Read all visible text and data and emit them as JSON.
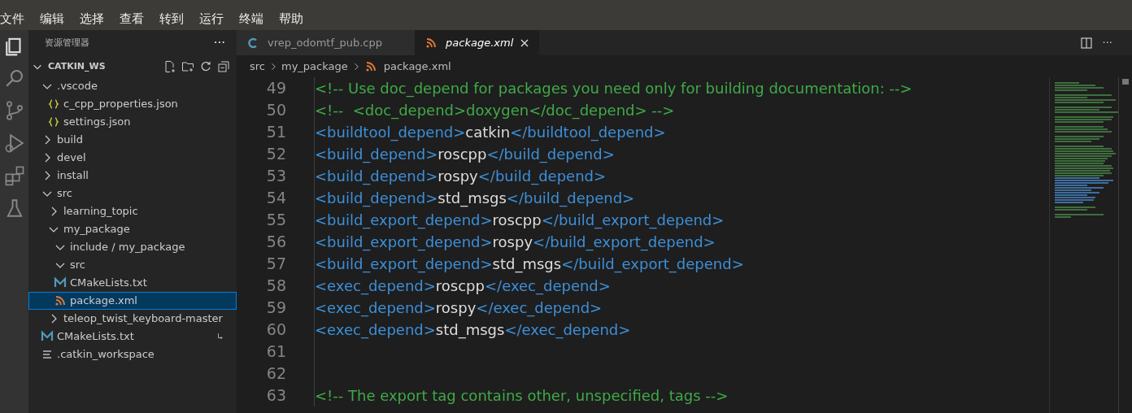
{
  "menu": [
    "文件",
    "编辑",
    "选择",
    "查看",
    "转到",
    "运行",
    "终端",
    "帮助"
  ],
  "activity_bar": [
    {
      "kind": "files",
      "selected": true
    },
    {
      "kind": "search",
      "selected": false
    },
    {
      "kind": "source-control",
      "selected": false
    },
    {
      "kind": "run",
      "selected": false
    },
    {
      "kind": "extensions",
      "selected": false
    },
    {
      "kind": "flask",
      "selected": false
    }
  ],
  "sidebar": {
    "title": "资源管理器",
    "more": "···",
    "workspace": "CATKIN_WS",
    "tree": [
      {
        "label": ".vscode",
        "kind": "folder",
        "expanded": true,
        "selected": false,
        "children": [
          {
            "label": "c_cpp_properties.json",
            "kind": "json",
            "selected": false
          },
          {
            "label": "settings.json",
            "kind": "json",
            "selected": false
          }
        ]
      },
      {
        "label": "build",
        "kind": "folder",
        "expanded": false,
        "selected": false
      },
      {
        "label": "devel",
        "kind": "folder",
        "expanded": false,
        "selected": false
      },
      {
        "label": "install",
        "kind": "folder",
        "expanded": false,
        "selected": false
      },
      {
        "label": "src",
        "kind": "folder",
        "expanded": true,
        "selected": false,
        "children": [
          {
            "label": "learning_topic",
            "kind": "folder",
            "expanded": false,
            "selected": false
          },
          {
            "label": "my_package",
            "kind": "folder",
            "expanded": true,
            "selected": false,
            "children": [
              {
                "label": "include / my_package",
                "kind": "folder",
                "expanded": true,
                "selected": false
              },
              {
                "label": "src",
                "kind": "folder",
                "expanded": true,
                "selected": false
              },
              {
                "label": "CMakeLists.txt",
                "kind": "cmake",
                "selected": false
              },
              {
                "label": "package.xml",
                "kind": "xml",
                "selected": true
              }
            ]
          },
          {
            "label": "teleop_twist_keyboard-master",
            "kind": "folder",
            "expanded": false,
            "selected": false
          }
        ]
      },
      {
        "label": "CMakeLists.txt",
        "kind": "cmake",
        "selected": false,
        "symlink": true
      },
      {
        "label": ".catkin_workspace",
        "kind": "text",
        "selected": false
      }
    ]
  },
  "tabs": [
    {
      "label": "vrep_odomtf_pub.cpp",
      "kind": "cpp",
      "selected": false
    },
    {
      "label": "package.xml",
      "kind": "xml",
      "selected": true
    }
  ],
  "tab_more": "···",
  "breadcrumbs": [
    {
      "label": "src",
      "kind": "folder"
    },
    {
      "label": "my_package",
      "kind": "folder"
    },
    {
      "label": "package.xml",
      "kind": "xml"
    }
  ],
  "code_lines": [
    {
      "number": "49",
      "segments": [
        {
          "kind": "comment",
          "text": "<!-- Use doc_depend for packages you need only for building documentation: -->"
        }
      ]
    },
    {
      "number": "50",
      "segments": [
        {
          "kind": "comment",
          "text": "<!--  <doc_depend>doxygen</doc_depend> -->"
        }
      ]
    },
    {
      "number": "51",
      "segments": [
        {
          "kind": "tag",
          "text": "<buildtool_depend>"
        },
        {
          "kind": "text",
          "text": "catkin"
        },
        {
          "kind": "tag",
          "text": "</buildtool_depend>"
        }
      ]
    },
    {
      "number": "52",
      "segments": [
        {
          "kind": "tag",
          "text": "<build_depend>"
        },
        {
          "kind": "text",
          "text": "roscpp"
        },
        {
          "kind": "tag",
          "text": "</build_depend>"
        }
      ]
    },
    {
      "number": "53",
      "segments": [
        {
          "kind": "tag",
          "text": "<build_depend>"
        },
        {
          "kind": "text",
          "text": "rospy"
        },
        {
          "kind": "tag",
          "text": "</build_depend>"
        }
      ]
    },
    {
      "number": "54",
      "segments": [
        {
          "kind": "tag",
          "text": "<build_depend>"
        },
        {
          "kind": "text",
          "text": "std_msgs"
        },
        {
          "kind": "tag",
          "text": "</build_depend>"
        }
      ]
    },
    {
      "number": "55",
      "segments": [
        {
          "kind": "tag",
          "text": "<build_export_depend>"
        },
        {
          "kind": "text",
          "text": "roscpp"
        },
        {
          "kind": "tag",
          "text": "</build_export_depend>"
        }
      ]
    },
    {
      "number": "56",
      "segments": [
        {
          "kind": "tag",
          "text": "<build_export_depend>"
        },
        {
          "kind": "text",
          "text": "rospy"
        },
        {
          "kind": "tag",
          "text": "</build_export_depend>"
        }
      ]
    },
    {
      "number": "57",
      "segments": [
        {
          "kind": "tag",
          "text": "<build_export_depend>"
        },
        {
          "kind": "text",
          "text": "std_msgs"
        },
        {
          "kind": "tag",
          "text": "</build_export_depend>"
        }
      ]
    },
    {
      "number": "58",
      "segments": [
        {
          "kind": "tag",
          "text": "<exec_depend>"
        },
        {
          "kind": "text",
          "text": "roscpp"
        },
        {
          "kind": "tag",
          "text": "</exec_depend>"
        }
      ]
    },
    {
      "number": "59",
      "segments": [
        {
          "kind": "tag",
          "text": "<exec_depend>"
        },
        {
          "kind": "text",
          "text": "rospy"
        },
        {
          "kind": "tag",
          "text": "</exec_depend>"
        }
      ]
    },
    {
      "number": "60",
      "segments": [
        {
          "kind": "tag",
          "text": "<exec_depend>"
        },
        {
          "kind": "text",
          "text": "std_msgs"
        },
        {
          "kind": "tag",
          "text": "</exec_depend>"
        }
      ]
    },
    {
      "number": "61"
    },
    {
      "number": "62"
    },
    {
      "number": "63",
      "segments": [
        {
          "kind": "comment",
          "text": "<!-- The export tag contains other, unspecified, tags -->"
        }
      ]
    }
  ]
}
